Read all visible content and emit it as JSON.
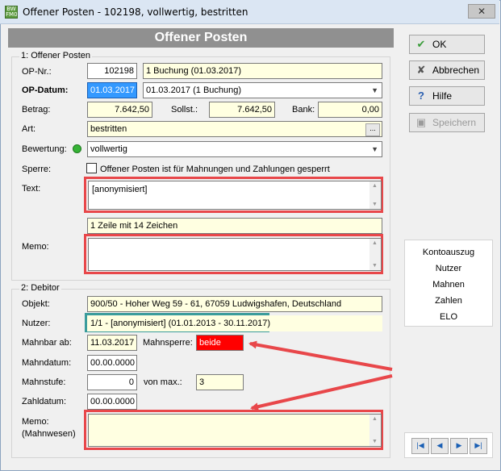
{
  "window": {
    "title": "Offener Posten - 102198, vollwertig, bestritten",
    "icon_text": "BW\nFM 0",
    "close_glyph": "✕"
  },
  "header": {
    "title": "Offener Posten"
  },
  "section1": {
    "title": "1: Offener Posten",
    "op_nr": {
      "label": "OP-Nr.:",
      "value": "102198",
      "booking": "1 Buchung (01.03.2017)"
    },
    "op_datum": {
      "label": "OP-Datum:",
      "value": "01.03.2017",
      "combo": "01.03.2017 (1 Buchung)"
    },
    "betrag": {
      "label": "Betrag:",
      "value": "7.642,50"
    },
    "sollst": {
      "label": "Sollst.:",
      "value": "7.642,50"
    },
    "bank": {
      "label": "Bank:",
      "value": "0,00"
    },
    "art": {
      "label": "Art:",
      "value": "bestritten",
      "button": "..."
    },
    "bewertung": {
      "label": "Bewertung:",
      "value": "vollwertig",
      "status_color": "#36b336"
    },
    "sperre": {
      "label": "Sperre:",
      "checkbox_label": "Offener Posten ist für Mahnungen und Zahlungen gesperrt",
      "checked": false
    },
    "text": {
      "label": "Text:",
      "value": "[anonymisiert]",
      "info": "1 Zeile mit 14 Zeichen"
    },
    "memo": {
      "label": "Memo:",
      "value": ""
    }
  },
  "section2": {
    "title": "2: Debitor",
    "objekt": {
      "label": "Objekt:",
      "value": "900/50 - Hoher Weg 59 - 61, 67059 Ludwigshafen, Deutschland"
    },
    "nutzer": {
      "label": "Nutzer:",
      "value": "1/1 - [anonymisiert] (01.01.2013 - 30.11.2017)"
    },
    "mahnbar_ab": {
      "label": "Mahnbar ab:",
      "value": "11.03.2017"
    },
    "mahnsperre": {
      "label": "Mahnsperre:",
      "value": "beide"
    },
    "mahndatum": {
      "label": "Mahndatum:",
      "value": "00.00.0000"
    },
    "mahnstufe": {
      "label": "Mahnstufe:",
      "value": "0",
      "max_label": "von max.:",
      "max_value": "3"
    },
    "zahldatum": {
      "label": "Zahldatum:",
      "value": "00.00.0000"
    },
    "memo_mahnwesen": {
      "label1": "Memo:",
      "label2": "(Mahnwesen)",
      "value": ""
    }
  },
  "buttons": {
    "ok": "OK",
    "abbrechen": "Abbrechen",
    "hilfe": "Hilfe",
    "speichern": "Speichern"
  },
  "side_links": [
    "Kontoauszug",
    "Nutzer",
    "Mahnen",
    "Zahlen",
    "ELO"
  ],
  "nav": {
    "first": "|◀",
    "prev": "◀",
    "next": "▶",
    "last": "▶|"
  },
  "colors": {
    "annotation_red": "#e8474a",
    "annotation_teal": "#3a9c9c",
    "mahnsperre_bg": "#ff0000",
    "field_yellow": "#ffffe1"
  }
}
